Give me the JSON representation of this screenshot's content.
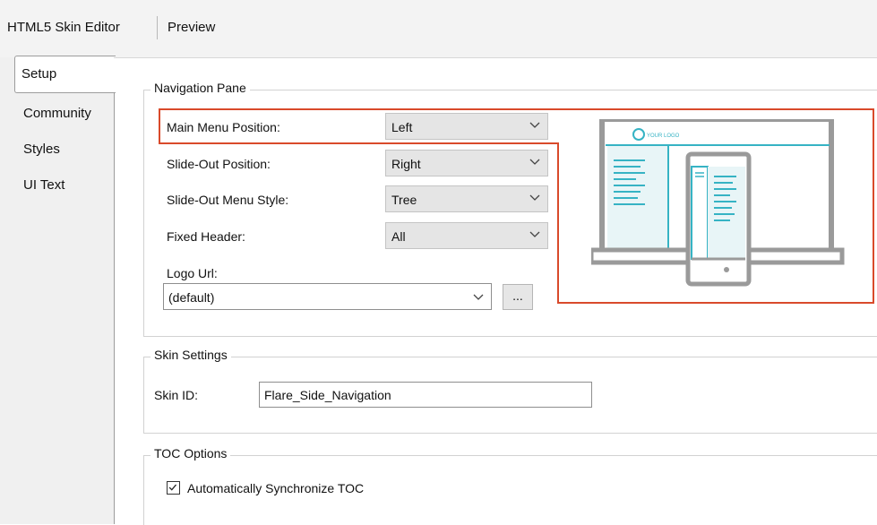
{
  "header": {
    "tabs": [
      "HTML5 Skin Editor",
      "Preview"
    ]
  },
  "sidebar": {
    "items": [
      "Setup",
      "Community",
      "Styles",
      "UI Text"
    ]
  },
  "navigation_pane": {
    "title": "Navigation Pane",
    "main_menu_position": {
      "label": "Main Menu Position:",
      "value": "Left"
    },
    "slide_out_position": {
      "label": "Slide-Out Position:",
      "value": "Right"
    },
    "slide_out_menu_style": {
      "label": "Slide-Out Menu Style:",
      "value": "Tree"
    },
    "fixed_header": {
      "label": "Fixed Header:",
      "value": "All"
    },
    "logo_url": {
      "label": "Logo Url:",
      "value": "(default)",
      "browse": "..."
    },
    "preview_logo_text": "YOUR LOGO"
  },
  "skin_settings": {
    "title": "Skin Settings",
    "skin_id_label": "Skin ID:",
    "skin_id_value": "Flare_Side_Navigation"
  },
  "toc_options": {
    "title": "TOC Options",
    "auto_sync_label": "Automatically Synchronize TOC",
    "auto_sync_checked": true
  },
  "colors": {
    "highlight": "#d94a2b",
    "preview_accent": "#36b3c4",
    "preview_frame": "#9a9a9a"
  }
}
